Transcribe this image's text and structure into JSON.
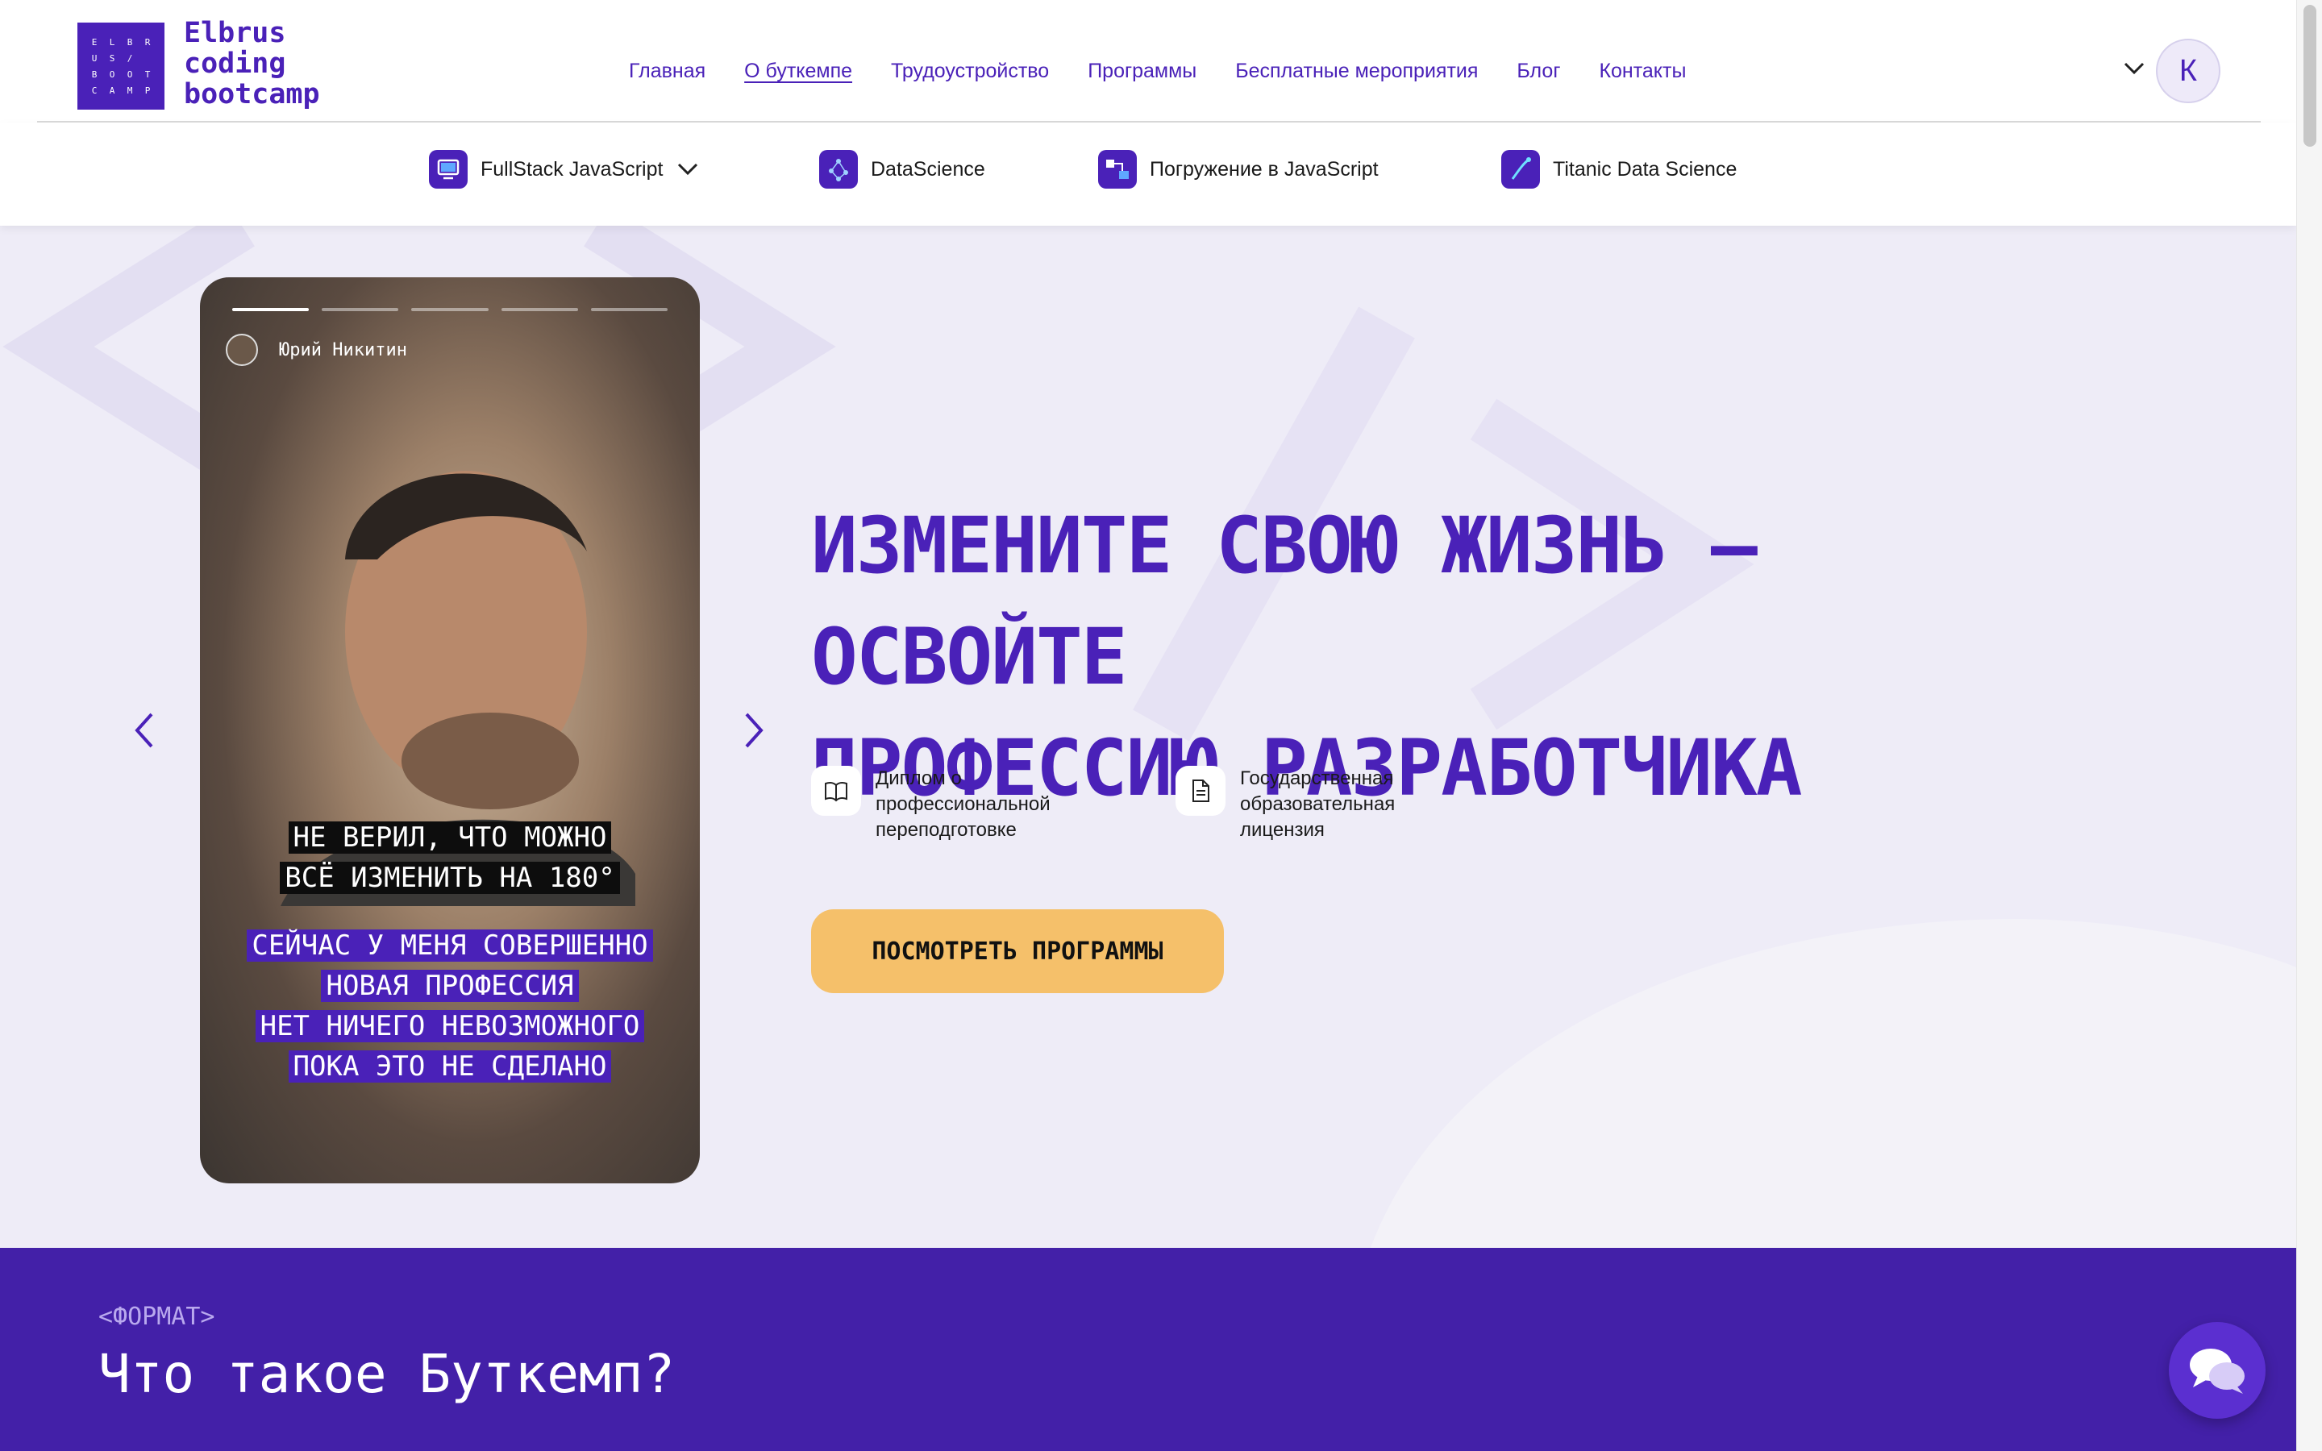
{
  "logo": {
    "box_letters": [
      "E",
      "L",
      "B",
      "R",
      "U",
      "S",
      "/",
      " ",
      "B",
      "O",
      "O",
      "T",
      "C",
      "A",
      "M",
      "P"
    ],
    "line1": "Elbrus",
    "line2": "coding",
    "line3": "bootcamp"
  },
  "nav": {
    "items": [
      {
        "label": "Главная",
        "active": false
      },
      {
        "label": "О буткемпе",
        "active": true
      },
      {
        "label": "Трудоустройство",
        "active": false
      },
      {
        "label": "Программы",
        "active": false
      },
      {
        "label": "Бесплатные мероприятия",
        "active": false
      },
      {
        "label": "Блог",
        "active": false
      },
      {
        "label": "Контакты",
        "active": false
      }
    ]
  },
  "user": {
    "avatar_letter": "К"
  },
  "programs": [
    {
      "label": "FullStack JavaScript",
      "has_dropdown": true
    },
    {
      "label": "DataScience",
      "has_dropdown": false
    },
    {
      "label": "Погружение в JavaScript",
      "has_dropdown": false
    },
    {
      "label": "Titanic Data Science",
      "has_dropdown": false
    }
  ],
  "story": {
    "author": "Юрий Никитин",
    "progress_total": 5,
    "progress_current": 1,
    "caption_dark": [
      "НЕ ВЕРИЛ, ЧТО МОЖНО",
      "ВСЁ ИЗМЕНИТЬ НА 180°"
    ],
    "caption_purple": [
      "СЕЙЧАС У МЕНЯ СОВЕРШЕННО",
      "НОВАЯ ПРОФЕССИЯ",
      "НЕТ НИЧЕГО НЕВОЗМОЖНОГО",
      "ПОКА ЭТО НЕ СДЕЛАНО"
    ]
  },
  "hero": {
    "headline_line1": "ИЗМЕНИТЕ СВОЮ ЖИЗНЬ — ОСВОЙТЕ",
    "headline_line2": "ПРОФЕССИЮ РАЗРАБОТЧИКА",
    "features": [
      {
        "icon": "book-icon",
        "text": "Диплом о профессиональной переподготовке"
      },
      {
        "icon": "document-icon",
        "text": "Государственная образовательная лицензия"
      }
    ],
    "cta_label": "ПОСМОТРЕТЬ ПРОГРАММЫ"
  },
  "section": {
    "tag": "<ФОРМАТ>",
    "title": "Что такое Буткемп?"
  },
  "colors": {
    "brand": "#4a21b8",
    "hero_bg": "#eeecf7",
    "cta": "#f5c06a",
    "section_bg": "#4320a8"
  }
}
